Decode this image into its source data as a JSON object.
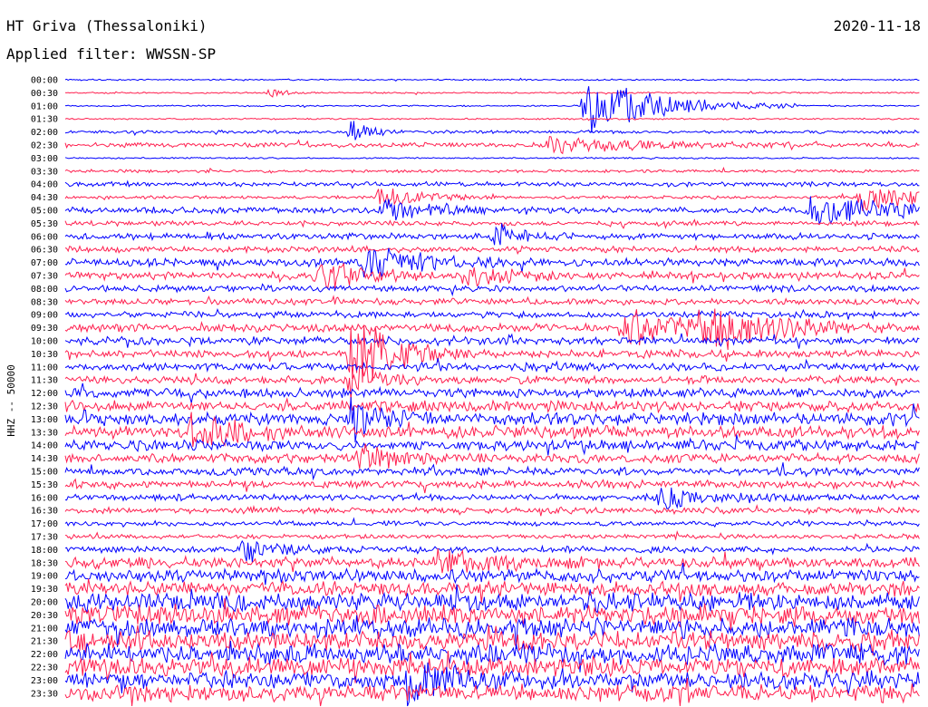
{
  "header": {
    "station": "HT Griva (Thessaloniki)",
    "filter": "Applied filter: WWSSN-SP",
    "date": "2020-11-18"
  },
  "colors": {
    "trace_a": "#0000ff",
    "trace_b": "#ff1f4f",
    "background": "#ffffff",
    "text": "#000000"
  },
  "chart_data": {
    "type": "line",
    "title": "HT Griva (Thessaloniki)",
    "subtitle": "Applied filter: WWSSN-SP",
    "date": "2020-11-18",
    "ylabel": "HHZ -- 50000",
    "xlabel": "",
    "y_ticks": [
      "00:00",
      "00:30",
      "01:00",
      "01:30",
      "02:00",
      "02:30",
      "03:00",
      "03:30",
      "04:00",
      "04:30",
      "05:00",
      "05:30",
      "06:00",
      "06:30",
      "07:00",
      "07:30",
      "08:00",
      "08:30",
      "09:00",
      "09:30",
      "10:00",
      "10:30",
      "11:00",
      "11:30",
      "12:00",
      "12:30",
      "13:00",
      "13:30",
      "14:00",
      "14:30",
      "15:00",
      "15:30",
      "16:00",
      "16:30",
      "17:00",
      "17:30",
      "18:00",
      "18:30",
      "19:00",
      "19:30",
      "20:00",
      "20:30",
      "21:00",
      "21:30",
      "22:00",
      "22:30",
      "23:00",
      "23:30"
    ],
    "trace_minutes": 30,
    "series_colors": [
      "#0000ff",
      "#ff1f4f"
    ],
    "noise_level": [
      1,
      1,
      1,
      1,
      2,
      3,
      1,
      2,
      3,
      2,
      4,
      3,
      4,
      4,
      5,
      5,
      4,
      4,
      4,
      5,
      5,
      5,
      5,
      5,
      6,
      7,
      8,
      8,
      7,
      6,
      5,
      5,
      4,
      4,
      3,
      3,
      4,
      7,
      8,
      9,
      12,
      13,
      13,
      13,
      13,
      12,
      11,
      11
    ],
    "events": [
      {
        "trace": "00:30",
        "minute": 7.2,
        "amp": 8,
        "dur": 0.4
      },
      {
        "trace": "02:00",
        "minute": 10.0,
        "amp": 18,
        "dur": 0.6
      },
      {
        "trace": "01:00",
        "minute": 18.2,
        "amp": 40,
        "dur": 2.5
      },
      {
        "trace": "02:30",
        "minute": 17.0,
        "amp": 12,
        "dur": 3.0
      },
      {
        "trace": "04:30",
        "minute": 11.0,
        "amp": 14,
        "dur": 1.5
      },
      {
        "trace": "05:00",
        "minute": 11.3,
        "amp": 22,
        "dur": 1.2
      },
      {
        "trace": "05:00",
        "minute": 26.0,
        "amp": 18,
        "dur": 3.5
      },
      {
        "trace": "04:30",
        "minute": 27.8,
        "amp": 20,
        "dur": 2.0
      },
      {
        "trace": "06:00",
        "minute": 15.0,
        "amp": 16,
        "dur": 1.0
      },
      {
        "trace": "07:00",
        "minute": 10.5,
        "amp": 22,
        "dur": 2.0
      },
      {
        "trace": "07:30",
        "minute": 8.8,
        "amp": 20,
        "dur": 1.5
      },
      {
        "trace": "07:30",
        "minute": 14.0,
        "amp": 18,
        "dur": 1.2
      },
      {
        "trace": "09:30",
        "minute": 19.5,
        "amp": 22,
        "dur": 3.0
      },
      {
        "trace": "09:30",
        "minute": 22.3,
        "amp": 30,
        "dur": 2.0
      },
      {
        "trace": "10:30",
        "minute": 10.0,
        "amp": 48,
        "dur": 1.6
      },
      {
        "trace": "11:30",
        "minute": 10.0,
        "amp": 30,
        "dur": 0.8
      },
      {
        "trace": "13:00",
        "minute": 10.0,
        "amp": 34,
        "dur": 1.0
      },
      {
        "trace": "13:30",
        "minute": 4.4,
        "amp": 24,
        "dur": 1.8
      },
      {
        "trace": "14:30",
        "minute": 10.3,
        "amp": 16,
        "dur": 1.5
      },
      {
        "trace": "16:00",
        "minute": 20.8,
        "amp": 14,
        "dur": 2.0
      },
      {
        "trace": "18:00",
        "minute": 6.2,
        "amp": 18,
        "dur": 1.0
      },
      {
        "trace": "18:30",
        "minute": 13.0,
        "amp": 16,
        "dur": 2.0
      },
      {
        "trace": "23:00",
        "minute": 12.0,
        "amp": 35,
        "dur": 1.5
      }
    ]
  }
}
